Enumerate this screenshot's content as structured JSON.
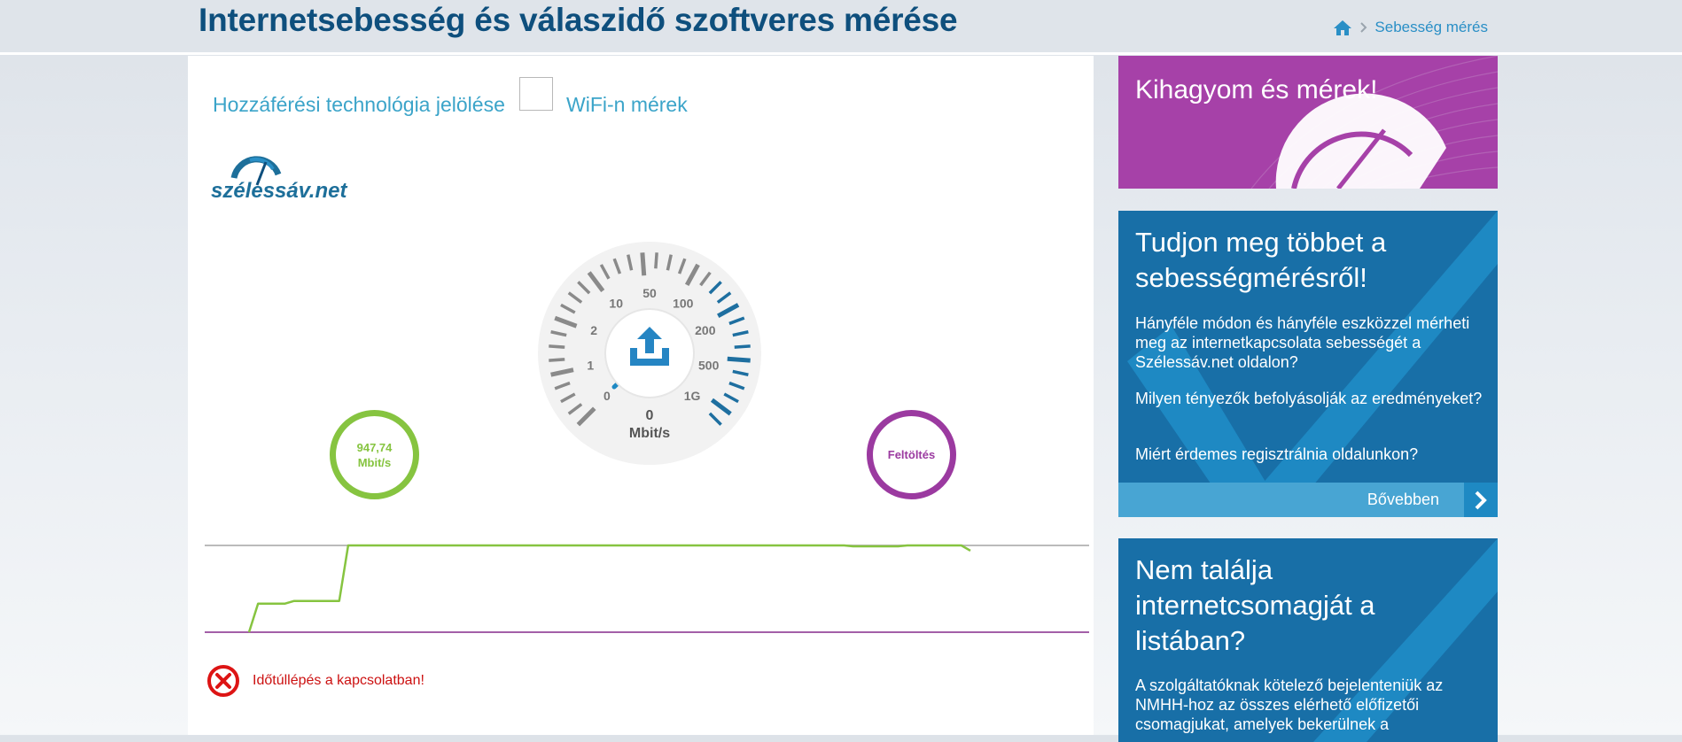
{
  "header": {
    "title": "Internetsebesség és válaszidő szoftveres mérése",
    "breadcrumb": {
      "current": "Sebesség mérés"
    }
  },
  "access": {
    "technology_label": "Hozzáférési technológia jelölése",
    "wifi_label": "WiFi-n mérek",
    "wifi_checked": false
  },
  "logo": {
    "text": "szélessáv.net"
  },
  "gauge": {
    "scale_labels": [
      "0",
      "1",
      "2",
      "10",
      "50",
      "100",
      "200",
      "500",
      "1G"
    ],
    "value": "0",
    "unit": "Mbit/s",
    "icon": "upload-icon"
  },
  "download_ring": {
    "value": "947,74",
    "unit": "Mbit/s"
  },
  "upload_ring": {
    "label": "Feltöltés"
  },
  "chart_data": {
    "type": "line",
    "series": [
      {
        "color": "#86c440",
        "values": [
          0,
          33,
          33,
          33,
          33,
          36,
          36,
          36,
          36,
          36,
          36,
          100,
          100,
          100,
          100,
          100,
          100,
          100,
          100,
          100,
          100,
          100,
          100,
          100,
          100,
          100,
          100,
          100,
          100,
          100,
          100,
          100,
          100,
          100,
          100,
          100,
          100,
          100,
          100,
          100,
          100,
          100,
          100,
          100,
          100,
          100,
          100,
          100,
          100,
          100,
          100,
          100,
          100,
          100,
          100,
          100,
          100,
          100,
          100,
          100,
          100,
          100,
          100,
          100,
          100,
          100,
          100,
          99,
          99,
          99,
          99,
          99,
          99,
          100,
          100,
          100,
          100,
          100,
          100,
          100,
          94
        ]
      }
    ],
    "ylim": [
      0,
      100
    ],
    "reference_lines": [
      {
        "color": "#bbbbbb"
      },
      {
        "color": "#a35fa8"
      }
    ]
  },
  "error": {
    "message": "Időtúllépés a kapcsolatban!"
  },
  "sidebar": {
    "skip_banner": {
      "title": "Kihagyom és mérek!"
    },
    "info_box": {
      "title_line1": "Tudjon meg többet a",
      "title_line2": "sebességmérésről!",
      "q1": "Hányféle módon és hányféle eszközzel mérheti meg az internetkapcsolata sebességét a Szélessáv.net oldalon?",
      "q2": "Milyen tényezők befolyásolják az eredményeket?",
      "q3": "Miért érdemes regisztrálnia oldalunkon?",
      "more_label": "Bővebben"
    },
    "package_box": {
      "title_line1": "Nem találja",
      "title_line2": "internetcsomagját a",
      "title_line3": "listában?",
      "text": "A szolgáltatóknak kötelező bejelenteniük az NMHH-hoz az összes elérhető előfizetői csomagjukat, amelyek bekerülnek a"
    }
  },
  "colors": {
    "title": "#0e4f7d",
    "accent": "#3ba4c9",
    "download": "#86c440",
    "upload": "#9b3aa0",
    "error": "#cc1111",
    "info_bg": "#186fa7"
  }
}
